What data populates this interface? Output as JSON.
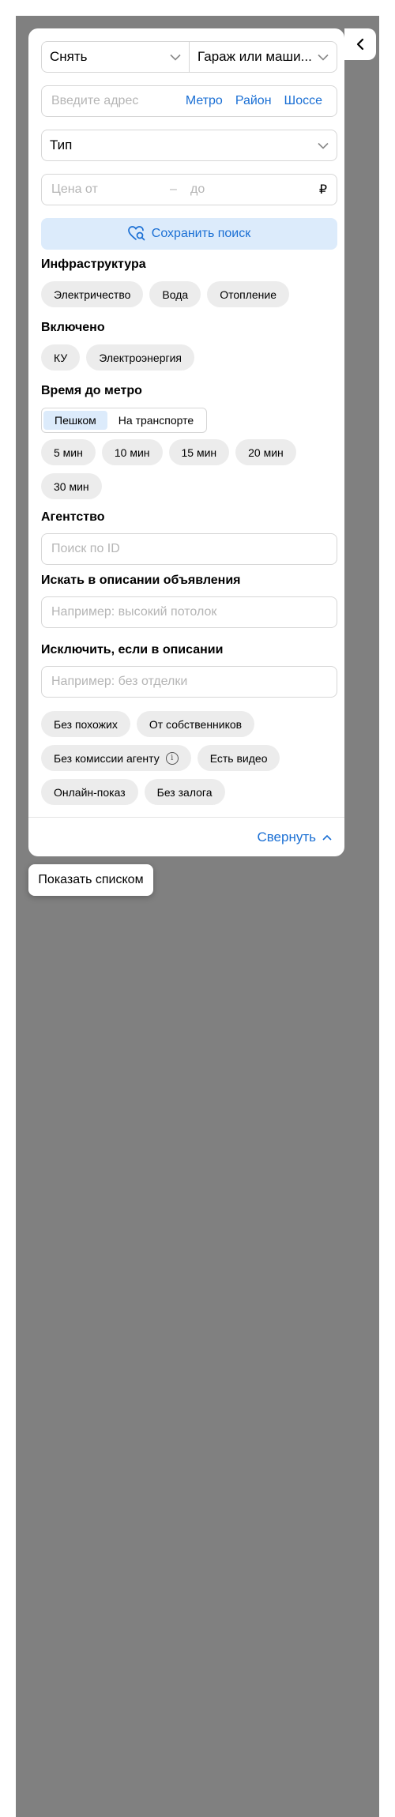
{
  "filters": {
    "deal_type": "Снять",
    "object_type": "Гараж или маши...",
    "address_placeholder": "Введите адрес",
    "address_links": [
      "Метро",
      "Район",
      "Шоссе"
    ],
    "type_label": "Тип",
    "price_from_placeholder": "Цена от",
    "price_dash": "–",
    "price_to_placeholder": "до",
    "currency": "₽",
    "save_search": "Сохранить поиск"
  },
  "infrastructure": {
    "title": "Инфраструктура",
    "options": [
      "Электричество",
      "Вода",
      "Отопление"
    ]
  },
  "included": {
    "title": "Включено",
    "options": [
      "КУ",
      "Электроэнергия"
    ]
  },
  "metro_time": {
    "title": "Время до метро",
    "modes": [
      "Пешком",
      "На транспорте"
    ],
    "active_mode": "Пешком",
    "options": [
      "5 мин",
      "10 мин",
      "15 мин",
      "20 мин",
      "30 мин"
    ]
  },
  "agency": {
    "title": "Агентство",
    "placeholder": "Поиск по ID"
  },
  "description_search": {
    "title": "Искать в описании объявления",
    "placeholder": "Например: высокий потолок"
  },
  "description_exclude": {
    "title": "Исключить, если в описании",
    "placeholder": "Например: без отделки"
  },
  "extra_options": [
    "Без похожих",
    "От собственников",
    "Без комиссии агенту",
    "Есть видео",
    "Онлайн-показ",
    "Без залога"
  ],
  "footer": {
    "collapse": "Свернуть",
    "show_list": "Показать списком"
  },
  "colors": {
    "accent": "#1a6fd4",
    "accent_bg": "#dcebfb",
    "chip_bg": "#ececec",
    "overlay": "#808080"
  }
}
